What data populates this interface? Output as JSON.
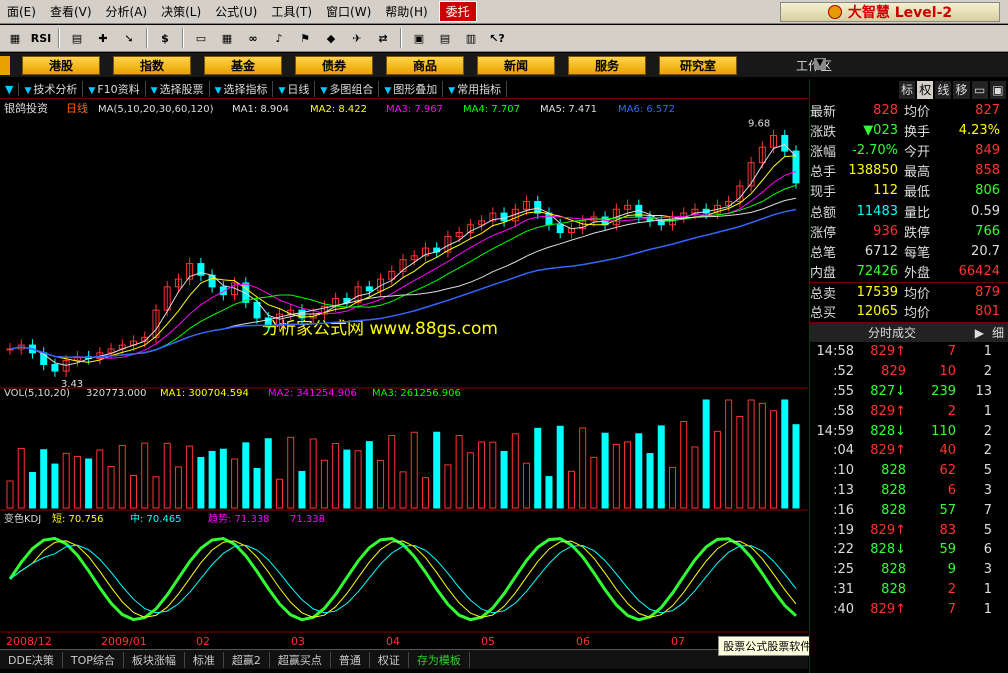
{
  "menu": [
    "面(E)",
    "查看(V)",
    "分析(A)",
    "决策(L)",
    "公式(U)",
    "工具(T)",
    "窗口(W)",
    "帮助(H)"
  ],
  "menu_wt": "委托",
  "brand": "大智慧 Level-2",
  "toolbar_icons": [
    "grid-icon",
    "rsi-icon",
    "table-icon",
    "crosshair-icon",
    "ruler-icon",
    "dollar-icon",
    "money-icon",
    "chart-icon",
    "binoculars-icon",
    "bell-icon",
    "flag-icon",
    "diamond-icon",
    "rocket-icon",
    "shuffle-icon",
    "save-icon",
    "window-icon",
    "books-icon",
    "help-cursor-icon"
  ],
  "toolbar_labels": [
    "▦",
    "RSI",
    "▤",
    "✚",
    "➘",
    "$",
    "▭",
    "▦",
    "∞",
    "♪",
    "⚑",
    "◆",
    "✈",
    "⇄",
    "▣",
    "▤",
    "▥",
    "↖?"
  ],
  "nav": [
    "港股",
    "指数",
    "基金",
    "债券",
    "商品",
    "新闻",
    "服务",
    "研究室"
  ],
  "workarea": "工作区",
  "subtoolbar": [
    "技术分析",
    "F10资料",
    "选择股票",
    "选择指标",
    "日线",
    "多图组合",
    "图形叠加",
    "常用指标"
  ],
  "chart_header": {
    "name": "银鸽投资",
    "period": "日线",
    "ma": "MA(5,10,20,30,60,120)",
    "ma1": "MA1: 8.904",
    "ma2": "MA2: 8.422",
    "ma3": "MA3: 7.967",
    "ma4": "MA4: 7.707",
    "ma5": "MA5: 7.471",
    "ma6": "MA6: 6.572"
  },
  "vol_header": {
    "name": "VOL(5,10,20)",
    "v": "320773.000",
    "ma1": "MA1: 300704.594",
    "ma2": "MA2: 341254.906",
    "ma3": "MA3: 261256.906"
  },
  "kdj_header": {
    "name": "变色KDJ",
    "a": "短: 70.756",
    "b": "中: 70.465",
    "c": "趋势: 71.338",
    "d": "71.338"
  },
  "watermark": "分析家公式网 www.88gs.com",
  "high_label": "9.68",
  "low_label": "3.43",
  "xaxis": [
    "2008/12",
    "2009/01",
    "02",
    "03",
    "04",
    "05",
    "06",
    "07"
  ],
  "tabs": [
    "DDE决策",
    "TOP综合",
    "板块涨幅",
    "标准",
    "超赢2",
    "超赢买点",
    "普通",
    "权证",
    "存为模板"
  ],
  "adbar": "股票公式股票软件下载[分析家公式网www.88gs.com]",
  "right_tabs": [
    "标",
    "权",
    "线",
    "移"
  ],
  "quote": [
    {
      "l": "最新",
      "v": "828",
      "vc": "red",
      "r": "均价",
      "v2": "827",
      "v2c": "red"
    },
    {
      "l": "涨跌",
      "v": "▼023",
      "vc": "grn",
      "r": "换手",
      "v2": "4.23%",
      "v2c": "yel"
    },
    {
      "l": "涨幅",
      "v": "-2.70%",
      "vc": "grn",
      "r": "今开",
      "v2": "849",
      "v2c": "red"
    },
    {
      "l": "总手",
      "v": "138850",
      "vc": "yel",
      "r": "最高",
      "v2": "858",
      "v2c": "red"
    },
    {
      "l": "现手",
      "v": "112",
      "vc": "yel",
      "r": "最低",
      "v2": "806",
      "v2c": "grn"
    },
    {
      "l": "总额",
      "v": "11483",
      "vc": "cyan",
      "r": "量比",
      "v2": "0.59",
      "v2c": "wht"
    },
    {
      "l": "涨停",
      "v": "936",
      "vc": "red",
      "r": "跌停",
      "v2": "766",
      "v2c": "grn"
    },
    {
      "l": "总笔",
      "v": "6712",
      "vc": "wht",
      "r": "每笔",
      "v2": "20.7",
      "v2c": "wht"
    },
    {
      "l": "内盘",
      "v": "72426",
      "vc": "grn",
      "r": "外盘",
      "v2": "66424",
      "v2c": "red"
    },
    {
      "l": "总卖",
      "v": "17539",
      "vc": "yel",
      "r": "均价",
      "v2": "879",
      "v2c": "red"
    },
    {
      "l": "总买",
      "v": "12065",
      "vc": "yel",
      "r": "均价",
      "v2": "801",
      "v2c": "red"
    }
  ],
  "ticks_title": "分时成交",
  "ticks_tail": "细",
  "ticks": [
    {
      "t": "14:58",
      "p": "829↑",
      "pc": "red",
      "v": "7",
      "vc": "red",
      "n": "1"
    },
    {
      "t": ":52",
      "p": "829",
      "pc": "red",
      "v": "10",
      "vc": "red",
      "n": "2"
    },
    {
      "t": ":55",
      "p": "827↓",
      "pc": "grn",
      "v": "239",
      "vc": "grn",
      "n": "13"
    },
    {
      "t": ":58",
      "p": "829↑",
      "pc": "red",
      "v": "2",
      "vc": "red",
      "n": "1"
    },
    {
      "t": "14:59",
      "p": "828↓",
      "pc": "grn",
      "v": "110",
      "vc": "grn",
      "n": "2"
    },
    {
      "t": ":04",
      "p": "829↑",
      "pc": "red",
      "v": "40",
      "vc": "red",
      "n": "2"
    },
    {
      "t": ":10",
      "p": "828",
      "pc": "grn",
      "v": "62",
      "vc": "red",
      "n": "5"
    },
    {
      "t": ":13",
      "p": "828",
      "pc": "grn",
      "v": "6",
      "vc": "red",
      "n": "3"
    },
    {
      "t": ":16",
      "p": "828",
      "pc": "grn",
      "v": "57",
      "vc": "grn",
      "n": "7"
    },
    {
      "t": ":19",
      "p": "829↑",
      "pc": "red",
      "v": "83",
      "vc": "red",
      "n": "5"
    },
    {
      "t": ":22",
      "p": "828↓",
      "pc": "grn",
      "v": "59",
      "vc": "grn",
      "n": "6"
    },
    {
      "t": ":25",
      "p": "828",
      "pc": "grn",
      "v": "9",
      "vc": "grn",
      "n": "3"
    },
    {
      "t": ":31",
      "p": "828",
      "pc": "grn",
      "v": "2",
      "vc": "red",
      "n": "1"
    },
    {
      "t": ":40",
      "p": "829↑",
      "pc": "red",
      "v": "7",
      "vc": "red",
      "n": "1"
    }
  ],
  "chart_data": {
    "type": "line",
    "price": {
      "min": 3.43,
      "max": 9.68,
      "close": [
        4.0,
        4.1,
        3.9,
        3.6,
        3.43,
        3.7,
        3.8,
        3.75,
        3.9,
        4.0,
        4.1,
        4.2,
        4.3,
        5.0,
        5.6,
        5.8,
        6.2,
        5.9,
        5.6,
        5.4,
        5.7,
        5.2,
        4.8,
        4.6,
        4.9,
        5.0,
        4.8,
        4.9,
        5.1,
        5.3,
        5.2,
        5.6,
        5.5,
        5.8,
        6.0,
        6.3,
        6.4,
        6.6,
        6.5,
        6.9,
        7.0,
        7.2,
        7.3,
        7.5,
        7.3,
        7.6,
        7.8,
        7.5,
        7.2,
        7.0,
        7.1,
        7.3,
        7.4,
        7.2,
        7.6,
        7.7,
        7.4,
        7.3,
        7.2,
        7.4,
        7.5,
        7.6,
        7.5,
        7.7,
        7.8,
        8.2,
        8.8,
        9.2,
        9.5,
        9.1,
        8.28
      ]
    },
    "ma": [
      {
        "name": "MA1",
        "value": 8.904
      },
      {
        "name": "MA2",
        "value": 8.422
      },
      {
        "name": "MA3",
        "value": 7.967
      },
      {
        "name": "MA4",
        "value": 7.707
      },
      {
        "name": "MA5",
        "value": 7.471
      },
      {
        "name": "MA6",
        "value": 6.572
      }
    ],
    "kdj": {
      "short": 70.756,
      "mid": 70.465,
      "trend": 71.338
    }
  }
}
